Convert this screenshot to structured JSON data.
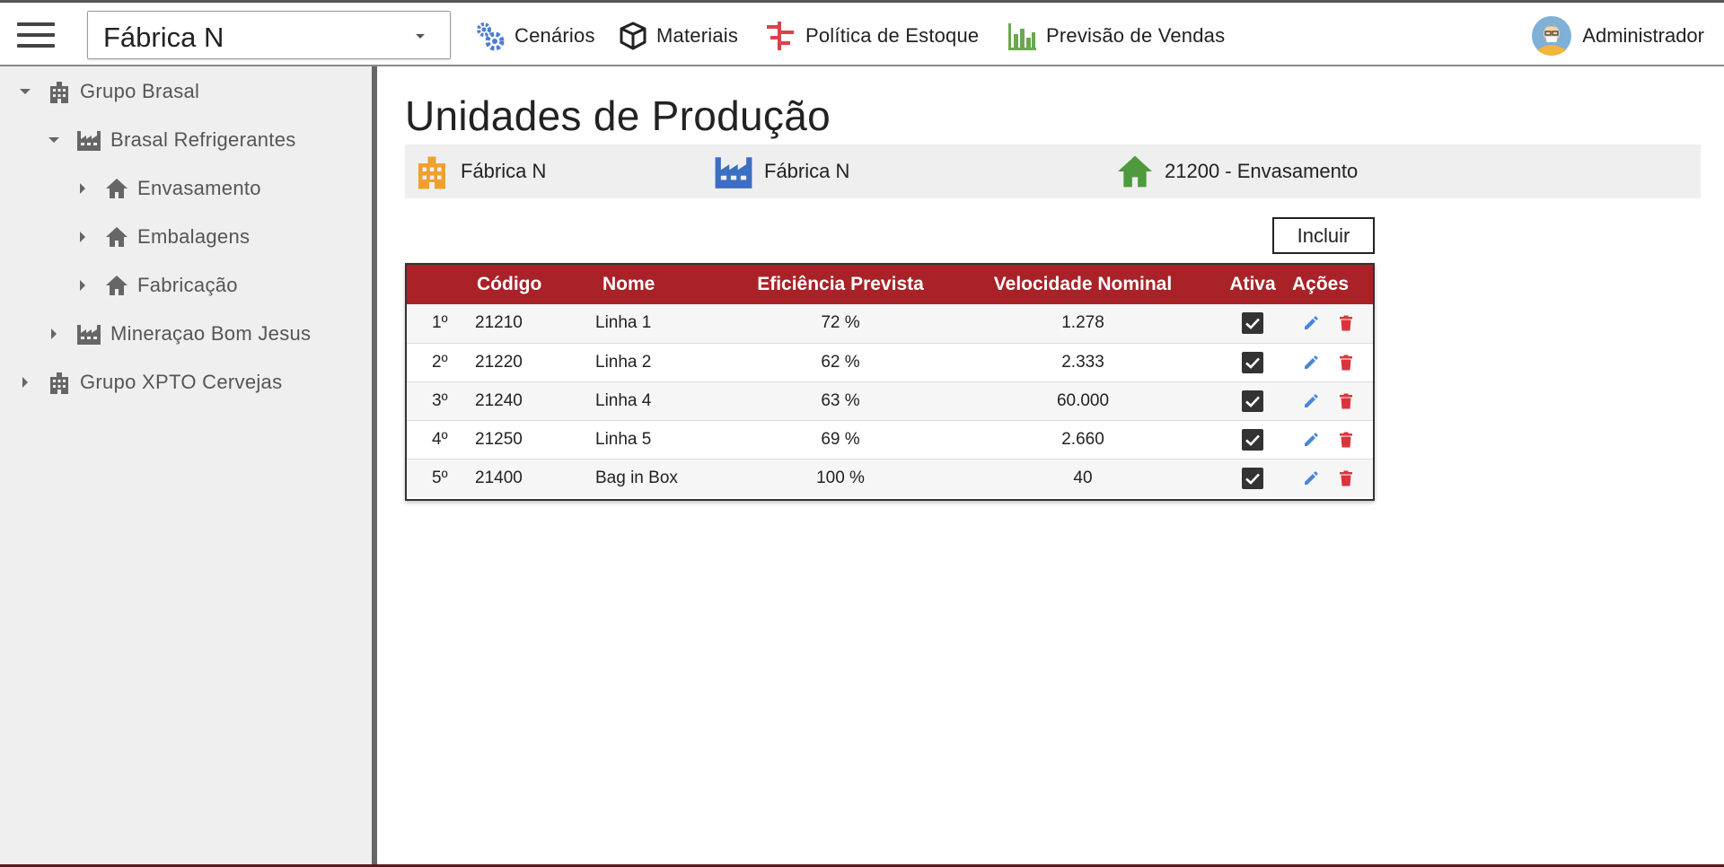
{
  "topbar": {
    "selector_value": "Fábrica N",
    "nav": [
      {
        "label": "Cenários",
        "icon": "gears-icon",
        "color": "#4a7fd4"
      },
      {
        "label": "Materiais",
        "icon": "box-icon",
        "color": "#222222"
      },
      {
        "label": "Política de Estoque",
        "icon": "stock-policy-icon",
        "color": "#d9434a"
      },
      {
        "label": "Previsão de Vendas",
        "icon": "bar-chart-icon",
        "color": "#6aa84f"
      }
    ],
    "user": {
      "name": "Administrador",
      "icon": "user-avatar-icon"
    }
  },
  "sidebar": {
    "items": [
      {
        "label": "Grupo Brasal",
        "icon": "building-icon",
        "expanded": true,
        "level": 0
      },
      {
        "label": "Brasal Refrigerantes",
        "icon": "factory-icon",
        "expanded": true,
        "level": 1
      },
      {
        "label": "Envasamento",
        "icon": "home-icon",
        "expanded": false,
        "level": 2
      },
      {
        "label": "Embalagens",
        "icon": "home-icon",
        "expanded": false,
        "level": 2
      },
      {
        "label": "Fabricação",
        "icon": "home-icon",
        "expanded": false,
        "level": 2
      },
      {
        "label": "Mineraçao Bom Jesus",
        "icon": "factory-icon",
        "expanded": false,
        "level": 1
      },
      {
        "label": "Grupo XPTO Cervejas",
        "icon": "building-icon",
        "expanded": false,
        "level": 0
      }
    ]
  },
  "main": {
    "title": "Unidades de Produção",
    "info": [
      {
        "label": "Fábrica N",
        "icon": "building-icon",
        "color": "#f0a030"
      },
      {
        "label": "Fábrica N",
        "icon": "factory-icon",
        "color": "#3a6fc4"
      },
      {
        "label": "21200 - Envasamento",
        "icon": "home-icon",
        "color": "#4e9a3c"
      }
    ],
    "include_label": "Incluir",
    "table": {
      "headers": [
        "",
        "Código",
        "Nome",
        "Eficiência Prevista",
        "Velocidade Nominal",
        "Ativa",
        "Ações"
      ],
      "rows": [
        {
          "idx": "1º",
          "codigo": "21210",
          "nome": "Linha 1",
          "eficiencia": "72 %",
          "velocidade": "1.278",
          "ativa": true
        },
        {
          "idx": "2º",
          "codigo": "21220",
          "nome": "Linha 2",
          "eficiencia": "62 %",
          "velocidade": "2.333",
          "ativa": true
        },
        {
          "idx": "3º",
          "codigo": "21240",
          "nome": "Linha 4",
          "eficiencia": "63 %",
          "velocidade": "60.000",
          "ativa": true
        },
        {
          "idx": "4º",
          "codigo": "21250",
          "nome": "Linha 5",
          "eficiencia": "69 %",
          "velocidade": "2.660",
          "ativa": true
        },
        {
          "idx": "5º",
          "codigo": "21400",
          "nome": "Bag in Box",
          "eficiencia": "100 %",
          "velocidade": "40",
          "ativa": true
        }
      ]
    }
  },
  "colors": {
    "header_red": "#a82227",
    "edit_blue": "#4a86d8",
    "delete_red": "#d9343c",
    "sidebar_bg": "#efefef"
  }
}
